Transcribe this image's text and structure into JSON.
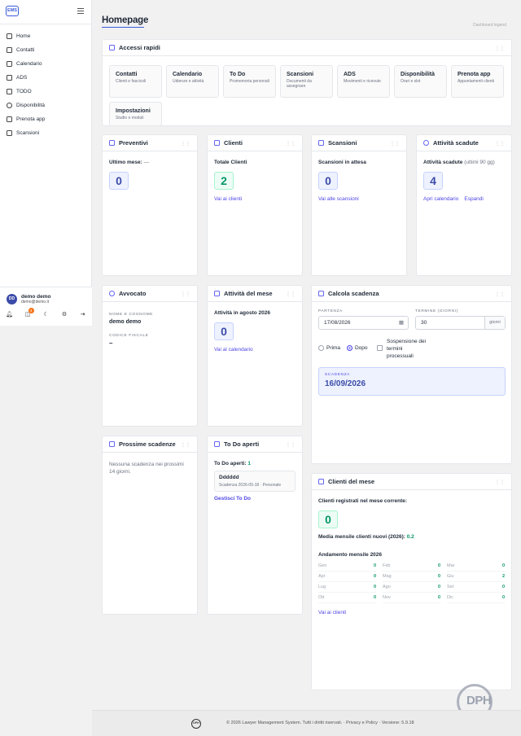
{
  "app": {
    "logo": "EMS"
  },
  "sidebar": {
    "items": [
      {
        "label": "Home",
        "icon": "home-icon"
      },
      {
        "label": "Contatti",
        "icon": "mail-icon"
      },
      {
        "label": "Calendario",
        "icon": "calendar-icon"
      },
      {
        "label": "ADS",
        "icon": "file-icon"
      },
      {
        "label": "TODO",
        "icon": "check-square-icon"
      },
      {
        "label": "Disponibilità",
        "icon": "clock-icon"
      },
      {
        "label": "Prenota app",
        "icon": "calendar-plus-icon"
      },
      {
        "label": "Scansioni",
        "icon": "scan-icon"
      }
    ],
    "user": {
      "initials": "DD",
      "name": "demo demo",
      "email": "demo@demo.it",
      "notifications_badge": "4"
    }
  },
  "page": {
    "title": "Homepage",
    "top_right": "Dashboard legend"
  },
  "quick_access": {
    "title": "Accessi rapidi",
    "items": [
      {
        "title": "Contatti",
        "subtitle": "Clienti e fascicoli"
      },
      {
        "title": "Calendario",
        "subtitle": "Udienze e attività"
      },
      {
        "title": "To Do",
        "subtitle": "Promemoria personali"
      },
      {
        "title": "Scansioni",
        "subtitle": "Documenti da assegnare"
      },
      {
        "title": "ADS",
        "subtitle": "Movimenti e ricevute"
      },
      {
        "title": "Disponibilità",
        "subtitle": "Orari e slot"
      },
      {
        "title": "Prenota app",
        "subtitle": "Appuntamenti clienti"
      },
      {
        "title": "Impostazioni",
        "subtitle": "Studio e moduli"
      }
    ]
  },
  "preventivi": {
    "title": "Preventivi",
    "label": "Ultimo mese:",
    "label_suffix": "—",
    "value": "0"
  },
  "clienti": {
    "title": "Clienti",
    "label": "Totale Clienti",
    "value": "2",
    "link": "Vai ai clienti"
  },
  "scansioni": {
    "title": "Scansioni",
    "label": "Scansioni in attesa",
    "value": "0",
    "link": "Vai alle scansioni"
  },
  "attivita_scadute": {
    "title": "Attività scadute",
    "label": "Attività scadute",
    "label_sub": "(ultimi 90 gg)",
    "value": "4",
    "link1": "Apri calendario",
    "link2": "Espandi"
  },
  "avvocato": {
    "title": "Avvocato",
    "name_label": "NOME E COGNOME",
    "name": "demo demo",
    "cf_label": "CODICE FISCALE",
    "cf": "–"
  },
  "attivita_mese": {
    "title": "Attività del mese",
    "label": "Attività in agosto 2026",
    "value": "0",
    "link": "Vai al calendario"
  },
  "calcola": {
    "title": "Calcola scadenza",
    "partenza_label": "PARTENZA",
    "partenza": "17/08/2026",
    "termine_label": "TERMINE (GIORNI)",
    "termine": "30",
    "termine_unit": "giorni",
    "prima": "Prima",
    "dopo": "Dopo",
    "sospensione": "Sospensione dei termini processuali",
    "scadenza_label": "SCADENZA",
    "scadenza": "16/09/2026"
  },
  "prossime": {
    "title": "Prossime scadenze",
    "text": "Nessuna scadenza nei prossimi 14 giorni."
  },
  "todo": {
    "title": "To Do aperti",
    "label": "To Do aperti:",
    "count": "1",
    "item_title": "Dddddd",
    "item_meta": "Scadenza 2026-05-18 · Personale",
    "link": "Gestisci To Do"
  },
  "clienti_mese": {
    "title": "Clienti del mese",
    "label": "Clienti registrati nel mese corrente:",
    "value": "0",
    "media_label": "Media mensile clienti nuovi (2026):",
    "media_value": "0.2",
    "trend_label": "Andamento mensile 2026",
    "months": [
      {
        "m": "Gen",
        "v": "0"
      },
      {
        "m": "Feb",
        "v": "0"
      },
      {
        "m": "Mar",
        "v": "0"
      },
      {
        "m": "Apr",
        "v": "0"
      },
      {
        "m": "Mag",
        "v": "0"
      },
      {
        "m": "Giu",
        "v": "2"
      },
      {
        "m": "Lug",
        "v": "0"
      },
      {
        "m": "Ago",
        "v": "0"
      },
      {
        "m": "Set",
        "v": "0"
      },
      {
        "m": "Ott",
        "v": "0"
      },
      {
        "m": "Nov",
        "v": "0"
      },
      {
        "m": "Dic",
        "v": "0"
      }
    ],
    "link": "Vai ai clienti"
  },
  "footer": {
    "text": "© 2026 Lawyer Management System. Tutti i diritti riservati. · Privacy e Policy · Versione: 5.9.18",
    "logo": "DPH"
  },
  "watermark": "DPH"
}
